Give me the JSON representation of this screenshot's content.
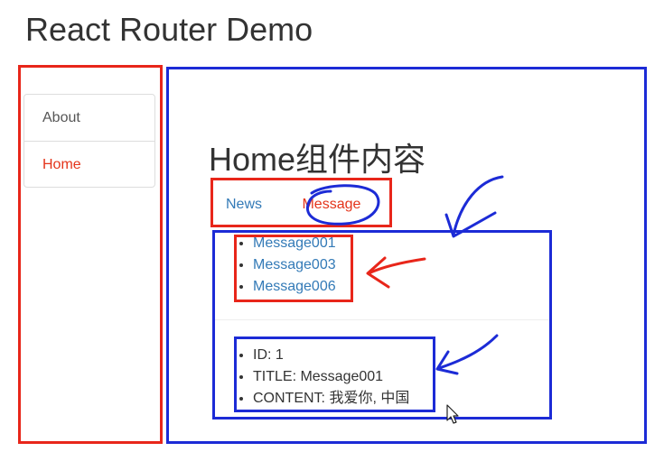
{
  "app": {
    "title": "React Router Demo"
  },
  "sidebar": {
    "items": [
      {
        "label": "About",
        "active": false
      },
      {
        "label": "Home",
        "active": true
      }
    ]
  },
  "home": {
    "heading": "Home组件内容",
    "tabs": [
      {
        "label": "News",
        "active": false
      },
      {
        "label": "Message",
        "active": true
      }
    ],
    "messages": [
      "Message001",
      "Message003",
      "Message006"
    ],
    "detail": {
      "id": "ID: 1",
      "title": "TITLE: Message001",
      "content": "CONTENT: 我爱你, 中国"
    }
  },
  "colors": {
    "active_link": "#e4341a",
    "link": "#337ab7",
    "annotation_red": "#e8261a",
    "annotation_blue": "#1c2bd6"
  },
  "icons": [
    "mouse-cursor-icon"
  ]
}
